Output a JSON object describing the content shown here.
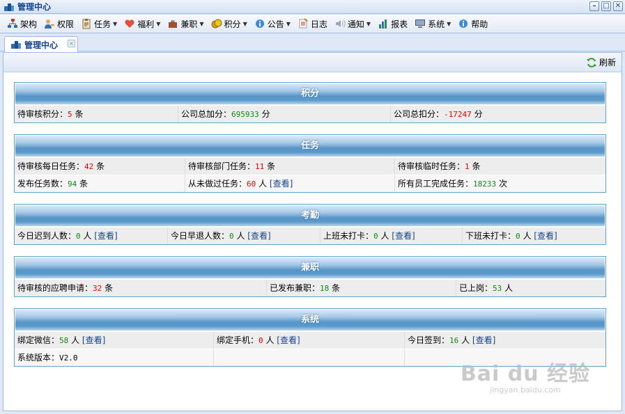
{
  "window": {
    "title": "管理中心",
    "minimize": "–",
    "maximize": "□",
    "close": "✕"
  },
  "menu": [
    {
      "label": "架构",
      "icon": "org-chart-icon",
      "dropdown": false
    },
    {
      "label": "权限",
      "icon": "user-key-icon",
      "dropdown": false
    },
    {
      "label": "任务",
      "icon": "clipboard-icon",
      "dropdown": true
    },
    {
      "label": "福利",
      "icon": "heart-icon",
      "dropdown": true
    },
    {
      "label": "兼职",
      "icon": "briefcase-icon",
      "dropdown": true
    },
    {
      "label": "积分",
      "icon": "coins-icon",
      "dropdown": true
    },
    {
      "label": "公告",
      "icon": "info-icon",
      "dropdown": true
    },
    {
      "label": "日志",
      "icon": "notepad-icon",
      "dropdown": false
    },
    {
      "label": "通知",
      "icon": "speaker-icon",
      "dropdown": true
    },
    {
      "label": "报表",
      "icon": "bar-chart-icon",
      "dropdown": false
    },
    {
      "label": "系统",
      "icon": "computer-icon",
      "dropdown": true
    },
    {
      "label": "帮助",
      "icon": "help-icon",
      "dropdown": false
    }
  ],
  "tab": {
    "label": "管理中心",
    "close": "×"
  },
  "toolbar": {
    "refresh": "刷新"
  },
  "link_text": "[查看]",
  "panels": {
    "points": {
      "title": "积分",
      "pending_label": "待审核积分：",
      "pending_value": "5",
      "pending_unit": " 条",
      "add_label": "公司总加分：",
      "add_value": "695933",
      "add_unit": " 分",
      "deduct_label": "公司总扣分：",
      "deduct_value": "-17247",
      "deduct_unit": " 分"
    },
    "tasks": {
      "title": "任务",
      "daily_label": "待审核每日任务：",
      "daily_value": "42",
      "daily_unit": " 条",
      "dept_label": "待审核部门任务：",
      "dept_value": "11",
      "dept_unit": " 条",
      "temp_label": "待审核临时任务：",
      "temp_value": "1",
      "temp_unit": " 条",
      "published_label": "发布任务数：",
      "published_value": "94",
      "published_unit": " 条",
      "never_label": "从未做过任务：",
      "never_value": "60",
      "never_unit": " 人 ",
      "completed_label": "所有员工完成任务：",
      "completed_value": "18233",
      "completed_unit": " 次"
    },
    "attendance": {
      "title": "考勤",
      "late_label": "今日迟到人数：",
      "late_value": "0",
      "late_unit": " 人 ",
      "early_label": "今日早退人数：",
      "early_value": "0",
      "early_unit": " 人 ",
      "in_label": "上班未打卡：",
      "in_value": "0",
      "in_unit": " 人 ",
      "out_label": "下班未打卡：",
      "out_value": "0",
      "out_unit": " 人 "
    },
    "parttime": {
      "title": "兼职",
      "apply_label": "待审核的应聘申请：",
      "apply_value": "32",
      "apply_unit": " 条",
      "posted_label": "已发布兼职：",
      "posted_value": "18",
      "posted_unit": " 条",
      "onboard_label": "已上岗：",
      "onboard_value": "53",
      "onboard_unit": " 人"
    },
    "system": {
      "title": "系统",
      "wechat_label": "绑定微信：",
      "wechat_value": "58",
      "wechat_unit": " 人 ",
      "phone_label": "绑定手机：",
      "phone_value": "0",
      "phone_unit": " 人 ",
      "signin_label": "今日签到：",
      "signin_value": "16",
      "signin_unit": " 人 ",
      "version_label": "系统版本：",
      "version_value": "V2.0"
    }
  },
  "watermark": {
    "main": "Bai du 经验",
    "sub": "jingyan.baidu.com"
  }
}
